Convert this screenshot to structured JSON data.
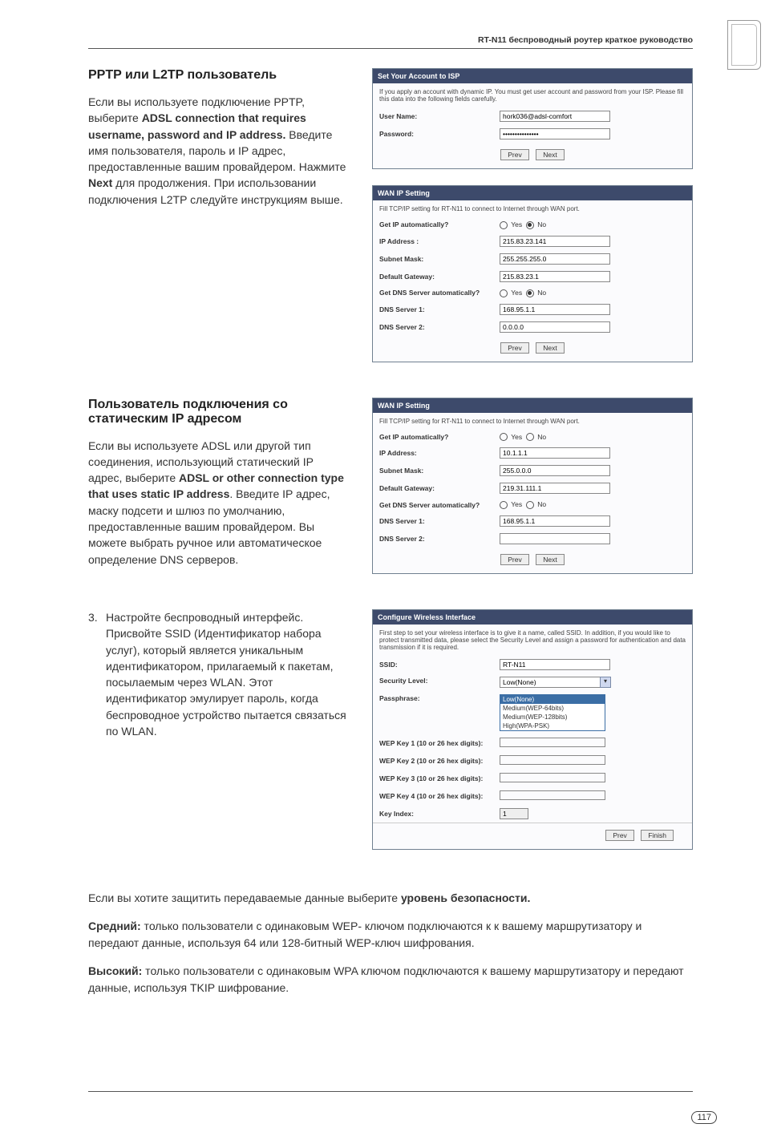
{
  "header": {
    "title": "RT-N11 беспроводный роутер краткое руководство"
  },
  "s1": {
    "heading": "PPTP или L2TP пользователь",
    "text_pre": "Если вы используете подключение PPTP, выберите ",
    "text_bold": "ADSL connection that requires username, password and IP address.",
    "text_mid": " Введите имя пользователя, пароль и IP адрес, предоставленные вашим провайдером. Нажмите ",
    "text_bold2": "Next",
    "text_post": " для продолжения. При использовании подключения L2TP следуйте инструкциям выше."
  },
  "panel1": {
    "title": "Set Your Account to ISP",
    "desc": "If you apply an account with dynamic IP. You must get user account and password from your ISP. Please fill this data into the following fields carefully.",
    "user_lbl": "User Name:",
    "user_val": "hork036@adsl-comfort",
    "pass_lbl": "Password:",
    "pass_val": "•••••••••••••••",
    "prev": "Prev",
    "next": "Next"
  },
  "panel2": {
    "title": "WAN IP Setting",
    "desc": "Fill TCP/IP setting for RT-N11 to connect to Internet through WAN port.",
    "r1_lbl": "Get IP automatically?",
    "r1_yes": "Yes",
    "r1_no": "No",
    "r2_lbl": "IP Address :",
    "r2_val": "215.83.23.141",
    "r3_lbl": "Subnet Mask:",
    "r3_val": "255.255.255.0",
    "r4_lbl": "Default Gateway:",
    "r4_val": "215.83.23.1",
    "r5_lbl": "Get DNS Server automatically?",
    "r6_lbl": "DNS Server 1:",
    "r6_val": "168.95.1.1",
    "r7_lbl": "DNS Server 2:",
    "r7_val": "0.0.0.0",
    "prev": "Prev",
    "next": "Next"
  },
  "s2": {
    "heading": "Пользователь подключения со статическим IP адресом",
    "t1": "Если вы используете ADSL или другой тип соединения, использующий статический IP адрес, выберите ",
    "t1b": "ADSL or other connection type that uses static IP address",
    "t2": ". Введите IP адрес, маску подсети и шлюз по умолчанию, предоставленные вашим провайдером. Вы можете выбрать ручное или автоматическое определение DNS серверов."
  },
  "panel3": {
    "title": "WAN IP Setting",
    "desc": "Fill TCP/IP setting for RT-N11 to connect to Internet through WAN port.",
    "r1_lbl": "Get IP automatically?",
    "yn_yes": "Yes",
    "yn_no": "No",
    "r2_lbl": "IP Address:",
    "r2_val": "10.1.1.1",
    "r3_lbl": "Subnet Mask:",
    "r3_val": "255.0.0.0",
    "r4_lbl": "Default Gateway:",
    "r4_val": "219.31.111.1",
    "r5_lbl": "Get DNS Server automatically?",
    "r6_lbl": "DNS Server 1:",
    "r6_val": "168.95.1.1",
    "r7_lbl": "DNS Server 2:",
    "r7_val": "",
    "prev": "Prev",
    "next": "Next"
  },
  "s3": {
    "num": "3.",
    "text": "Настройте беспроводный интерфейс. Присвойте SSID (Идентификатор набора услуг), который является уникальным идентификатором, прилагаемый к пакетам, посылаемым через WLAN. Этот идентификатор эмулирует пароль, когда беспроводное устройство пытается связаться по WLAN."
  },
  "panel4": {
    "title": "Configure Wireless Interface",
    "desc": "First step to set your wireless interface is to give it a name, called SSID. In addition, if you would like to protect transmitted data, please select the Security Level and assign a password for authentication and data transmission if it is required.",
    "r1_lbl": "SSID:",
    "r1_val": "RT-N11",
    "r2_lbl": "Security Level:",
    "r2_val": "Low(None)",
    "sel_o1": "Low(None)",
    "sel_o2": "Medium(WEP-64bits)",
    "sel_o3": "Medium(WEP-128bits)",
    "sel_o4": "High(WPA-PSK)",
    "r3_lbl": "Passphrase:",
    "r4_lbl": "WEP Key 1 (10 or 26 hex digits):",
    "r5_lbl": "WEP Key 2 (10 or 26 hex digits):",
    "r6_lbl": "WEP Key 3 (10 or 26 hex digits):",
    "r7_lbl": "WEP Key 4 (10 or 26 hex digits):",
    "r8_lbl": "Key Index:",
    "r8_val": "1",
    "prev": "Prev",
    "finish": "Finish"
  },
  "footer": {
    "p1a": "Если вы хотите защитить передаваемые данные выберите ",
    "p1b": "уровень безопасности.",
    "p2b": "Средний:",
    "p2": " только пользователи с одинаковым WEP- ключом подключаются к к вашему маршрутизатору и передают данные, используя  64 или 128-битный  WEP-ключ шифрования.",
    "p3b": "Высокий:",
    "p3": " только пользователи с одинаковым WPA ключом подключаются к вашему маршрутизатору и передают данные, используя TKIP шифрование."
  },
  "pageno": "117"
}
